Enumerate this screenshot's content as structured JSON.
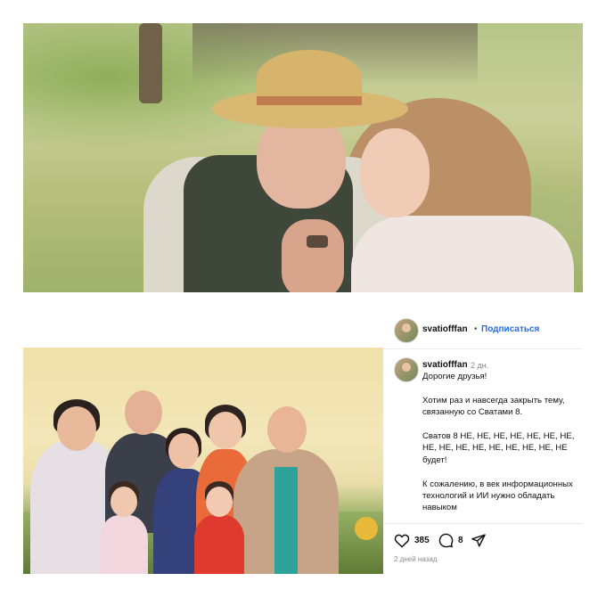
{
  "post": {
    "username": "svatiofffan",
    "follow_label": "Подписаться",
    "separator": "•",
    "comment_username": "svatiofffan",
    "comment_time": "2 дн.",
    "caption": [
      "Дорогие друзья!",
      "Хотим раз и навсегда закрыть тему, связанную со Сватами 8.",
      "Сватов 8 НЕ, НЕ, НЕ, НЕ, НЕ, НЕ, НЕ, НЕ, НЕ, НЕ, НЕ, НЕ, НЕ, НЕ, НЕ, НЕ будет!",
      "К сожалению, в век информационных технологий и ИИ нужно обладать навыком"
    ],
    "likes": "385",
    "comments": "8",
    "date": "2 дней назад"
  },
  "colors": {
    "link_blue": "#2a6fd8",
    "text_dark": "#111111",
    "text_muted": "#8a8a8a"
  },
  "icons": {
    "like": "heart-icon",
    "comment": "comment-bubble-icon",
    "share": "send-arrow-icon"
  }
}
